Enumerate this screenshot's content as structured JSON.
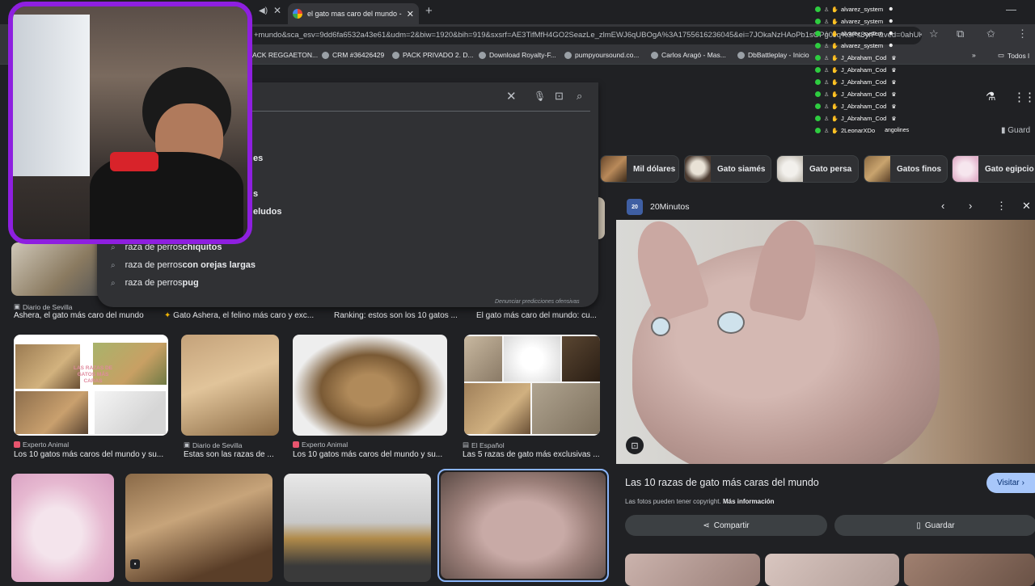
{
  "browser": {
    "tab_title": "el gato mas caro del mundo - B",
    "url": "+mundo&sca_esv=9dd6fa6532a43e61&udm=2&biw=1920&bih=919&sxsrf=AE3TifMfH4GO2SeazLe_zlmEWJ6qUBOgA%3A1755616236045&ei=7JOkaNzHAoPb1sOPg0Jq%3Fs8yrF-&ved=0ahUKEwjc...",
    "bookmarks": [
      "ACK REGGAETON...",
      "CRM #36426429",
      "PACK PRIVADO 2. D...",
      "Download Royalty-F...",
      "pumpyoursound.co...",
      "Carlos Aragó - Mas...",
      "DbBattleplay - Inicio"
    ],
    "all_bookmarks": "Todos l"
  },
  "header": {
    "saved_link": "Guard"
  },
  "chips": [
    {
      "label": "Mil dólares"
    },
    {
      "label": "Gato siamés"
    },
    {
      "label": "Gato persa"
    },
    {
      "label": "Gatos finos"
    },
    {
      "label": "Gato egipcio"
    }
  ],
  "suggestions": {
    "fragments": [
      "es",
      "s",
      "eludos"
    ],
    "items": [
      {
        "prefix": "raza de perros ",
        "bold": "chiquitos"
      },
      {
        "prefix": "raza de perros ",
        "bold": "con orejas largas"
      },
      {
        "prefix": "raza de perros ",
        "bold": "pug"
      }
    ],
    "report": "Denunciar predicciones ofensivas"
  },
  "results": {
    "row1": [
      {
        "source": "Diario de Sevilla",
        "title": "Ashera, el gato más caro del mundo"
      },
      {
        "source": "",
        "title": "Gato Ashera, el felino más caro y exc..."
      },
      {
        "source": "",
        "title": "Ranking: estos son los 10 gatos ..."
      },
      {
        "source": "",
        "title": "El gato más caro del mundo: cu..."
      }
    ],
    "row2": [
      {
        "source": "Experto Animal",
        "title": "Los 10 gatos más caros del mundo y su...",
        "image_text": "LAS RAZAS DE GATOS MÁS CARAS"
      },
      {
        "source": "Diario de Sevilla",
        "title": "Estas son las razas de ..."
      },
      {
        "source": "Experto Animal",
        "title": "Los 10 gatos más caros del mundo y su..."
      },
      {
        "source": "El Español",
        "title": "Las 5 razas de gato más exclusivas ..."
      }
    ]
  },
  "panel": {
    "site_logo": "20",
    "site": "20Minutos",
    "title": "Las 10 razas de gato más caras del mundo",
    "visit": "Visitar",
    "copyright": "Las fotos pueden tener copyright.",
    "more_info": "Más información",
    "share": "Compartir",
    "save": "Guardar"
  },
  "overlay": {
    "viewers": [
      "alvarez_system",
      "alvarez_system",
      "alvarez_system",
      "alvarez_system",
      "J_Abraham_Cod",
      "J_Abraham_Cod",
      "J_Abraham_Cod",
      "J_Abraham_Cod",
      "J_Abraham_Cod",
      "J_Abraham_Cod",
      "2LeonarXDo"
    ],
    "extra_name": "angolines"
  },
  "colors": {
    "page_bg": "#202124",
    "accent_blue": "#8ab4f8",
    "visit_btn": "#a8c7fa",
    "webcam_border": "#8e1fe0"
  }
}
